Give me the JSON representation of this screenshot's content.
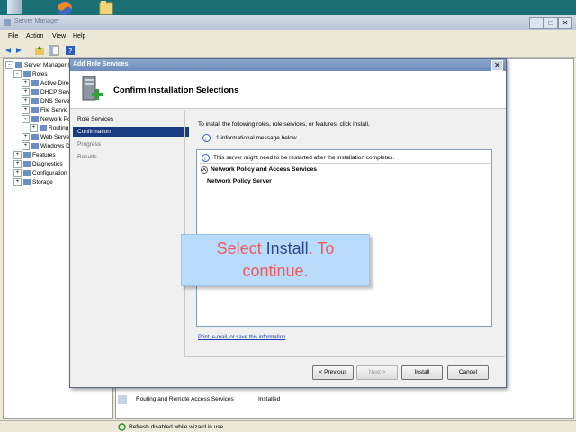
{
  "desktop": {
    "icons": [
      "server-manager-icon",
      "firefox-icon",
      "folder-icon"
    ]
  },
  "server_manager": {
    "title": "Server Manager",
    "menus": [
      "File",
      "Action",
      "View",
      "Help"
    ],
    "tree": [
      {
        "label": "Server Manager (S",
        "level": 0,
        "expander": "-"
      },
      {
        "label": "Roles",
        "level": 1,
        "expander": "-"
      },
      {
        "label": "Active Direc",
        "level": 2,
        "expander": "+"
      },
      {
        "label": "DHCP Serve",
        "level": 2,
        "expander": "+"
      },
      {
        "label": "DNS Serve",
        "level": 2,
        "expander": "+"
      },
      {
        "label": "File Servic",
        "level": 2,
        "expander": "+"
      },
      {
        "label": "Network Po",
        "level": 2,
        "expander": "-"
      },
      {
        "label": "Routing",
        "level": 3,
        "expander": "+"
      },
      {
        "label": "Web Serve",
        "level": 2,
        "expander": "+"
      },
      {
        "label": "Windows D",
        "level": 2,
        "expander": "+"
      },
      {
        "label": "Features",
        "level": 1,
        "expander": "+"
      },
      {
        "label": "Diagnostics",
        "level": 1,
        "expander": "+"
      },
      {
        "label": "Configuration",
        "level": 1,
        "expander": "+"
      },
      {
        "label": "Storage",
        "level": 1,
        "expander": "+"
      }
    ],
    "background_row": {
      "service": "Routing and Remote Access Services",
      "status": "Installed"
    },
    "status_text": "Refresh disabled while wizard in use"
  },
  "dialog": {
    "title": "Add Role Services",
    "close": "✕",
    "header": "Confirm Installation Selections",
    "nav": [
      {
        "label": "Role Services",
        "state": "normal"
      },
      {
        "label": "Confirmation",
        "state": "active"
      },
      {
        "label": "Progress",
        "state": "dim"
      },
      {
        "label": "Results",
        "state": "dim"
      }
    ],
    "intro": "To install the following roles, role services, or features, click Install.",
    "info_count": "1 informational message below",
    "warning": "This server might need to be restarted after the installation completes.",
    "role_heading": "Network Policy and Access Services",
    "role_item": "Network Policy Server",
    "link": "Print, e-mail, or save this information",
    "buttons": {
      "previous": "< Previous",
      "next": "Next >",
      "install": "Install",
      "cancel": "Cancel"
    }
  },
  "callout": {
    "part1": "Select ",
    "part2": "Install",
    "part3": ". To continue."
  }
}
